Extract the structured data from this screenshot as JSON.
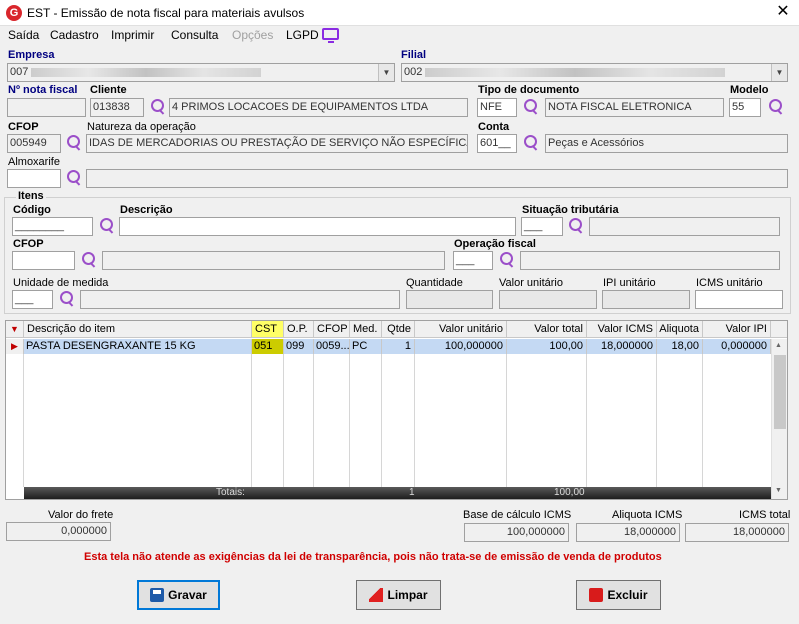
{
  "window": {
    "title": "EST - Emissão de nota fiscal para materiais avulsos",
    "close": "✕",
    "app_glyph": "G"
  },
  "menu": [
    "Saída",
    "Cadastro",
    "Imprimir",
    "Consulta",
    "Opções",
    "LGPD"
  ],
  "header": {
    "empresa_label": "Empresa",
    "empresa_value": "007",
    "filial_label": "Filial",
    "filial_value": "002",
    "nota_label": "Nº nota fiscal",
    "nota_value": "",
    "cliente_label": "Cliente",
    "cliente_code": "013838",
    "cliente_name": "4 PRIMOS LOCACOES DE EQUIPAMENTOS LTDA",
    "tipodoc_label": "Tipo de documento",
    "tipodoc_code": "NFE",
    "tipodoc_desc": "NOTA FISCAL ELETRONICA",
    "modelo_label": "Modelo",
    "modelo_value": "55",
    "cfop_label": "CFOP",
    "cfop_value": "005949",
    "natureza_label": "Natureza da operação",
    "natureza_value": "IDAS DE MERCADORIAS OU PRESTAÇÃO DE SERVIÇO NÃO ESPECÍFICAS",
    "conta_label": "Conta",
    "conta_code": "601__",
    "conta_desc": "Peças e Acessórios",
    "almox_label": "Almoxarife",
    "almox_code": "",
    "almox_desc": ""
  },
  "itens": {
    "title": "Itens",
    "codigo_label": "Código",
    "codigo_value": "________",
    "descricao_label": "Descrição",
    "descricao_value": "",
    "sit_label": "Situação tributária",
    "sit_value": "___",
    "cfop_label": "CFOP",
    "cfop_value": "",
    "opfiscal_label": "Operação fiscal",
    "opfiscal_value": "___",
    "unidade_label": "Unidade de medida",
    "unidade_value": "___",
    "qtd_label": "Quantidade",
    "vunit_label": "Valor unitário",
    "ipi_label": "IPI unitário",
    "icms_label": "ICMS unitário"
  },
  "grid": {
    "headers": [
      "Descrição do item",
      "CST",
      "O.P.",
      "CFOP",
      "Med.",
      "Qtde",
      "Valor unitário",
      "Valor total",
      "Valor ICMS",
      "Aliquota",
      "Valor IPI"
    ],
    "rows": [
      [
        "PASTA DESENGRAXANTE 15 KG",
        "051",
        "099",
        "0059...",
        "PC",
        "1",
        "100,000000",
        "100,00",
        "18,000000",
        "18,00",
        "0,000000"
      ]
    ],
    "totals_label": "Totais:",
    "totals_qtde": "1",
    "totals_valor": "100,00"
  },
  "footer": {
    "frete_label": "Valor do frete",
    "frete_value": "0,000000",
    "base_label": "Base de cálculo ICMS",
    "base_value": "100,000000",
    "aliq_label": "Aliquota ICMS",
    "aliq_value": "18,000000",
    "icms_total_label": "ICMS total",
    "icms_total_value": "18,000000",
    "notice": "Esta tela não atende as exigências da lei de transparência, pois não trata-se de emissão de venda de produtos"
  },
  "buttons": {
    "gravar": "Gravar",
    "limpar": "Limpar",
    "excluir": "Excluir"
  }
}
